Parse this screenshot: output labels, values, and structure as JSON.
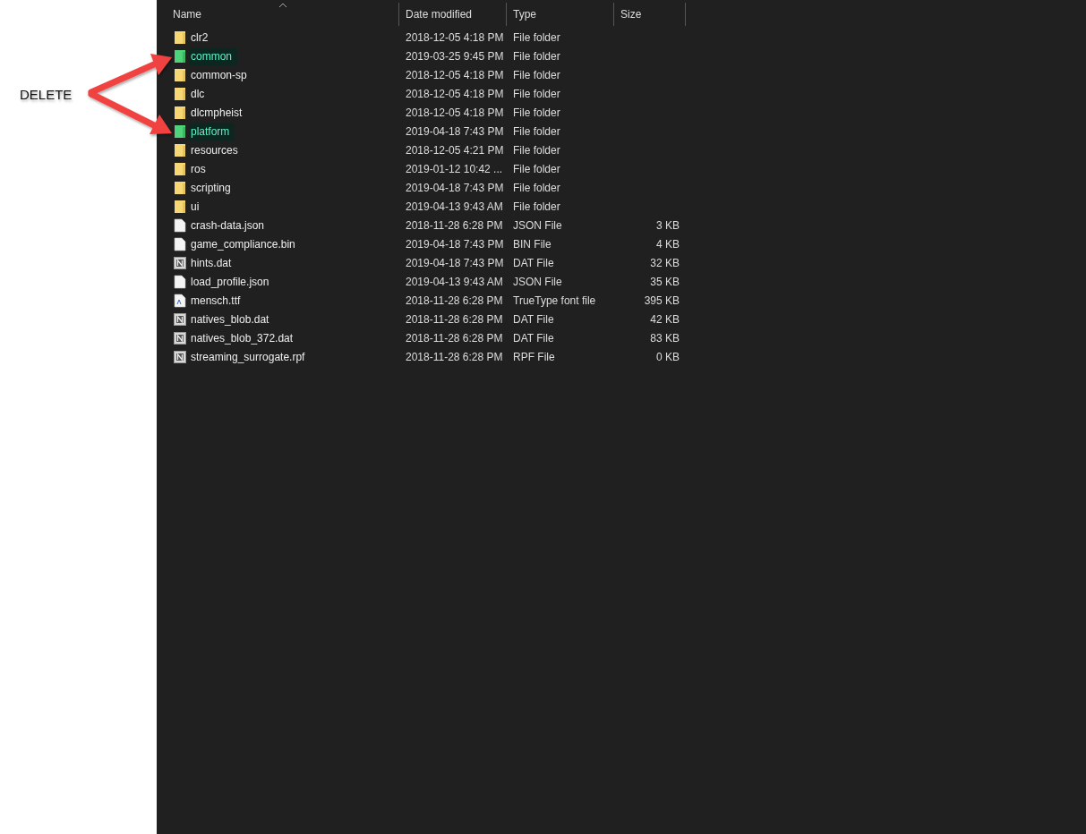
{
  "annotation": {
    "label": "DELETE"
  },
  "columns": [
    {
      "label": "Name",
      "sorted": true
    },
    {
      "label": "Date modified",
      "sorted": false
    },
    {
      "label": "Type",
      "sorted": false
    },
    {
      "label": "Size",
      "sorted": false
    }
  ],
  "rows": [
    {
      "kind": "folder",
      "name": "clr2",
      "date": "2018-12-05 4:18 PM",
      "type": "File folder",
      "highlighted": false
    },
    {
      "kind": "folder",
      "name": "common",
      "date": "2019-03-25 9:45 PM",
      "type": "File folder",
      "highlighted": true
    },
    {
      "kind": "folder",
      "name": "common-sp",
      "date": "2018-12-05 4:18 PM",
      "type": "File folder",
      "highlighted": false
    },
    {
      "kind": "folder",
      "name": "dlc",
      "date": "2018-12-05 4:18 PM",
      "type": "File folder",
      "highlighted": false
    },
    {
      "kind": "folder",
      "name": "dlcmpheist",
      "date": "2018-12-05 4:18 PM",
      "type": "File folder",
      "highlighted": false
    },
    {
      "kind": "folder",
      "name": "platform",
      "date": "2019-04-18 7:43 PM",
      "type": "File folder",
      "highlighted": true
    },
    {
      "kind": "folder",
      "name": "resources",
      "date": "2018-12-05 4:21 PM",
      "type": "File folder",
      "highlighted": false
    },
    {
      "kind": "folder",
      "name": "ros",
      "date": "2019-01-12 10:42 ...",
      "type": "File folder",
      "highlighted": false
    },
    {
      "kind": "folder",
      "name": "scripting",
      "date": "2019-04-18 7:43 PM",
      "type": "File folder",
      "highlighted": false
    },
    {
      "kind": "folder",
      "name": "ui",
      "date": "2019-04-13 9:43 AM",
      "type": "File folder",
      "highlighted": false
    },
    {
      "kind": "file",
      "name": "crash-data.json",
      "date": "2018-11-28 6:28 PM",
      "type": "JSON File",
      "size": "3 KB",
      "highlighted": false
    },
    {
      "kind": "file",
      "name": "game_compliance.bin",
      "date": "2019-04-18 7:43 PM",
      "type": "BIN File",
      "size": "4 KB",
      "highlighted": false
    },
    {
      "kind": "dat",
      "name": "hints.dat",
      "date": "2019-04-18 7:43 PM",
      "type": "DAT File",
      "size": "32 KB",
      "highlighted": false
    },
    {
      "kind": "file",
      "name": "load_profile.json",
      "date": "2019-04-13 9:43 AM",
      "type": "JSON File",
      "size": "35 KB",
      "highlighted": false
    },
    {
      "kind": "font",
      "name": "mensch.ttf",
      "date": "2018-11-28 6:28 PM",
      "type": "TrueType font file",
      "size": "395 KB",
      "highlighted": false
    },
    {
      "kind": "dat",
      "name": "natives_blob.dat",
      "date": "2018-11-28 6:28 PM",
      "type": "DAT File",
      "size": "42 KB",
      "highlighted": false
    },
    {
      "kind": "dat",
      "name": "natives_blob_372.dat",
      "date": "2018-11-28 6:28 PM",
      "type": "DAT File",
      "size": "83 KB",
      "highlighted": false
    },
    {
      "kind": "dat",
      "name": "streaming_surrogate.rpf",
      "date": "2018-11-28 6:28 PM",
      "type": "RPF File",
      "size": "0 KB",
      "highlighted": false
    }
  ]
}
